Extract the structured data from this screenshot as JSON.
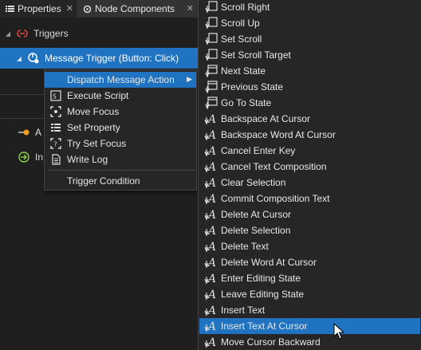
{
  "tabs": [
    {
      "label": "Properties",
      "icon": "list-icon"
    },
    {
      "label": "Node Components",
      "icon": "component-icon"
    }
  ],
  "tree": {
    "triggers_label": "Triggers",
    "message_trigger_label": "Message Trigger (Button: Click)",
    "row_a_label": "A",
    "row_b_label": "In"
  },
  "context_menu": {
    "items": [
      {
        "label": "Dispatch Message Action",
        "icon": "",
        "highlighted": true,
        "submenu": true
      },
      {
        "label": "Execute Script",
        "icon": "script-icon"
      },
      {
        "label": "Move Focus",
        "icon": "focus-icon"
      },
      {
        "label": "Set Property",
        "icon": "set-property-icon"
      },
      {
        "label": "Try Set Focus",
        "icon": "try-focus-icon"
      },
      {
        "label": "Write Log",
        "icon": "log-icon"
      }
    ],
    "trigger_condition": "Trigger Condition"
  },
  "submenu": {
    "items": [
      {
        "label": "Scroll Right",
        "icon": "scroll-icon"
      },
      {
        "label": "Scroll Up",
        "icon": "scroll-icon"
      },
      {
        "label": "Set Scroll",
        "icon": "scroll-icon"
      },
      {
        "label": "Set Scroll Target",
        "icon": "scroll-icon"
      },
      {
        "label": "Next State",
        "icon": "state-icon"
      },
      {
        "label": "Previous State",
        "icon": "state-icon"
      },
      {
        "label": "Go To State",
        "icon": "state-icon"
      },
      {
        "label": "Backspace At Cursor",
        "icon": "text-icon"
      },
      {
        "label": "Backspace Word At Cursor",
        "icon": "text-icon"
      },
      {
        "label": "Cancel Enter Key",
        "icon": "text-icon"
      },
      {
        "label": "Cancel Text Composition",
        "icon": "text-icon"
      },
      {
        "label": "Clear Selection",
        "icon": "text-icon"
      },
      {
        "label": "Commit Composition Text",
        "icon": "text-icon"
      },
      {
        "label": "Delete At Cursor",
        "icon": "text-icon"
      },
      {
        "label": "Delete Selection",
        "icon": "text-icon"
      },
      {
        "label": "Delete Text",
        "icon": "text-icon"
      },
      {
        "label": "Delete Word At Cursor",
        "icon": "text-icon"
      },
      {
        "label": "Enter Editing State",
        "icon": "text-icon"
      },
      {
        "label": "Leave Editing State",
        "icon": "text-icon"
      },
      {
        "label": "Insert Text",
        "icon": "text-icon"
      },
      {
        "label": "Insert Text At Cursor",
        "icon": "text-icon",
        "highlighted": true
      },
      {
        "label": "Move Cursor Backward",
        "icon": "text-icon"
      }
    ]
  },
  "colors": {
    "accent": "#1f73c1",
    "trigger_red": "#e0443e",
    "background": "#1e1e1e"
  }
}
